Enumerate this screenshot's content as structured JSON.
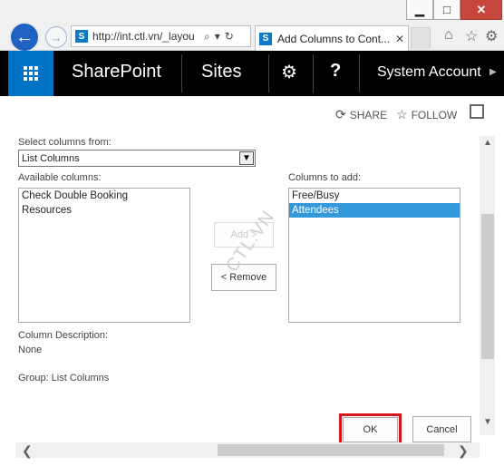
{
  "browser": {
    "url": "http://int.ctl.vn/_layou",
    "tab_title": "Add Columns to Cont...",
    "window_controls": [
      "minimize",
      "maximize",
      "close"
    ]
  },
  "suite_bar": {
    "brand": "SharePoint",
    "sites": "Sites",
    "help": "?",
    "account": "System Account"
  },
  "actions": {
    "share": "SHARE",
    "follow": "FOLLOW"
  },
  "form": {
    "select_columns_label": "Select columns from:",
    "select_value": "List Columns",
    "available_label": "Available columns:",
    "available_items": [
      "Check Double Booking",
      "Resources"
    ],
    "to_add_label": "Columns to add:",
    "to_add_items": [
      "Free/Busy",
      "Attendees"
    ],
    "selected_to_add_index": 1,
    "add_button": "Add >",
    "remove_button": "< Remove",
    "column_description_label": "Column Description:",
    "column_description_value": "None",
    "group_text": "Group: List Columns",
    "ok_button": "OK",
    "cancel_button": "Cancel",
    "watermark": "CTL.VN"
  },
  "colors": {
    "suite_bg": "#000000",
    "waffle_bg": "#0072c6",
    "selected_item": "#3399db",
    "ok_highlight": "#d9141c"
  }
}
